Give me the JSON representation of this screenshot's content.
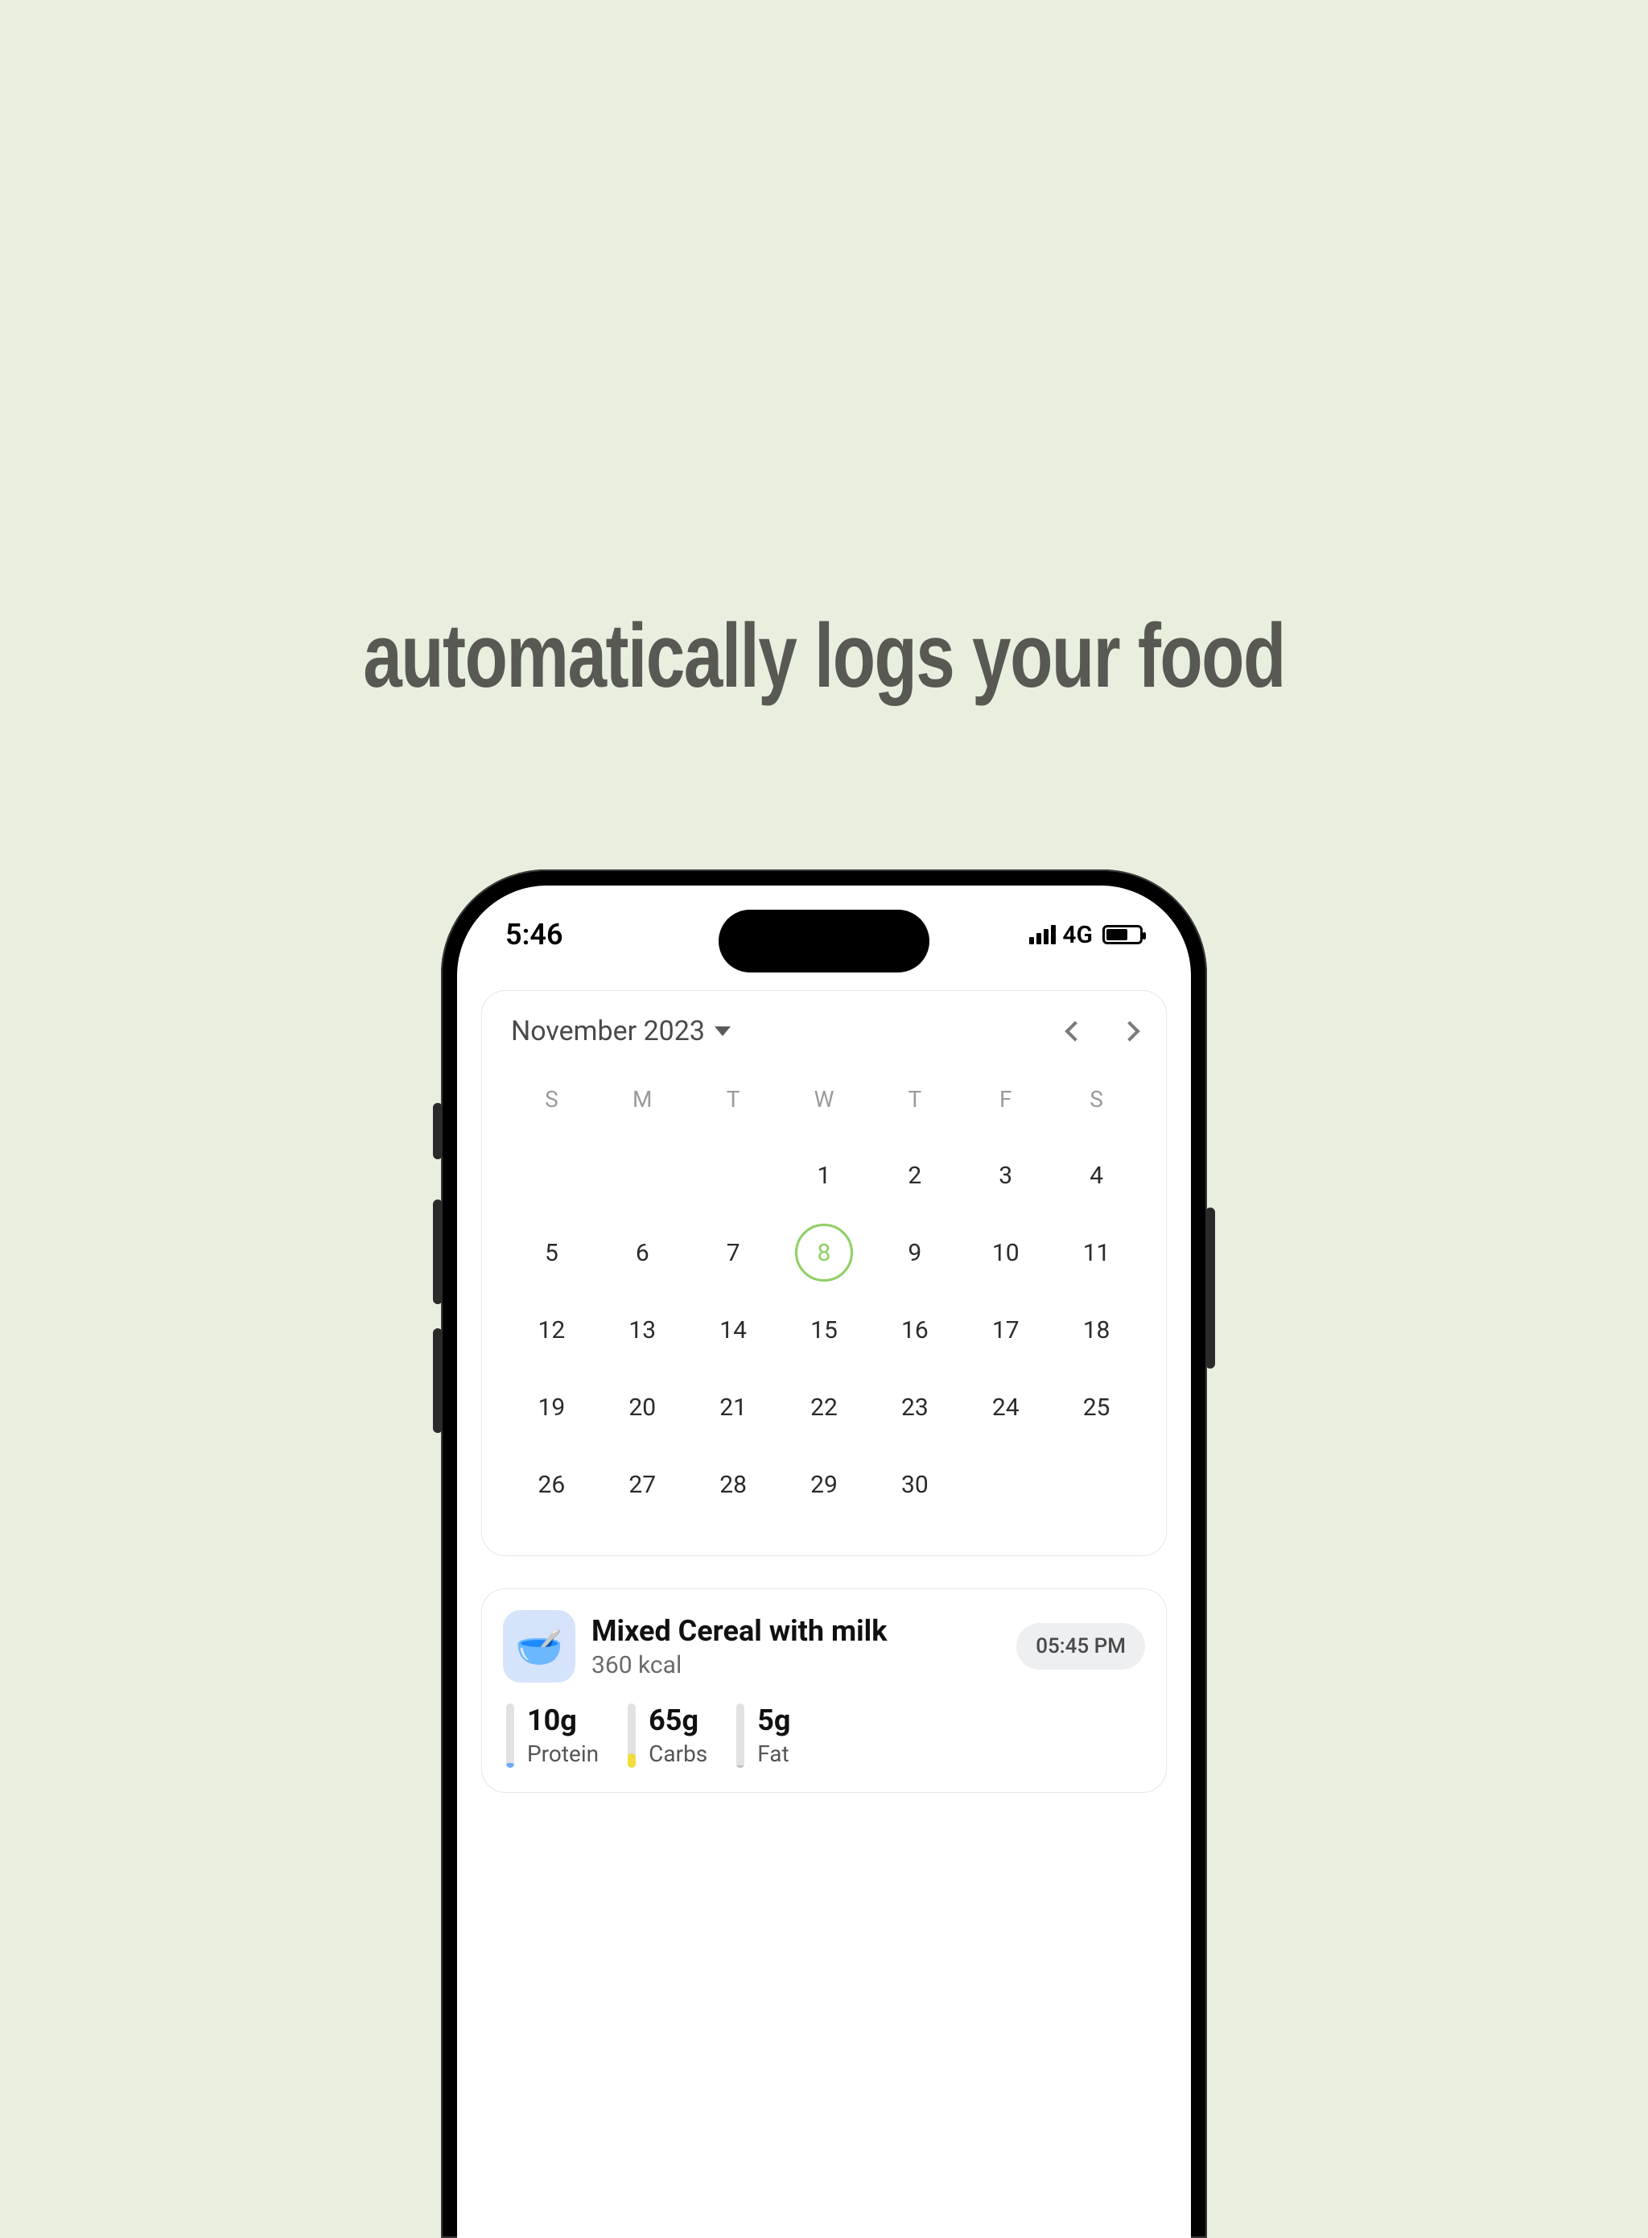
{
  "headline": "automatically logs your food",
  "status": {
    "time": "5:46",
    "network": "4G"
  },
  "calendar": {
    "title": "November 2023",
    "dows": [
      "S",
      "M",
      "T",
      "W",
      "T",
      "F",
      "S"
    ],
    "leading_blanks": 3,
    "days": [
      1,
      2,
      3,
      4,
      5,
      6,
      7,
      8,
      9,
      10,
      11,
      12,
      13,
      14,
      15,
      16,
      17,
      18,
      19,
      20,
      21,
      22,
      23,
      24,
      25,
      26,
      27,
      28,
      29,
      30
    ],
    "selected": 8
  },
  "food": {
    "icon_emoji": "🥣",
    "name": "Mixed Cereal with milk",
    "calories": "360 kcal",
    "time": "05:45 PM",
    "macros": {
      "protein": {
        "amount": "10g",
        "label": "Protein"
      },
      "carbs": {
        "amount": "65g",
        "label": "Carbs"
      },
      "fat": {
        "amount": "5g",
        "label": "Fat"
      }
    }
  }
}
